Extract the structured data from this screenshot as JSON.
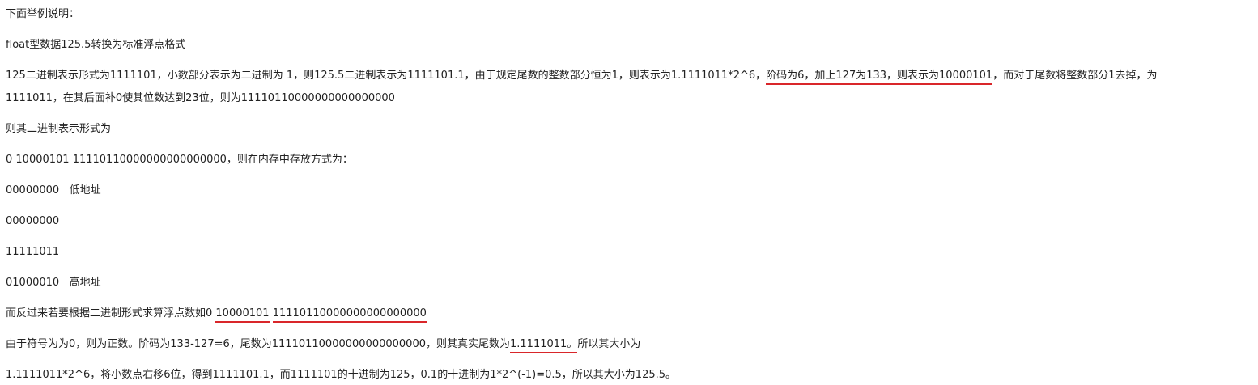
{
  "lines": {
    "l1": "下面举例说明：",
    "l2": "float型数据125.5转换为标准浮点格式",
    "l3a": "125二进制表示形式为1111101，小数部分表示为二进制为 1，则125.5二进制表示为1111101.1，由于规定尾数的整数部分恒为1，则表示为1.1111011*2^6，",
    "l3b": "阶码为6，加上127为133，则表示为10000101",
    "l3c": "，而对于尾数将整数部分1去掉，为",
    "l4": "1111011，在其后面补0使其位数达到23位，则为11110110000000000000000",
    "l5": "则其二进制表示形式为",
    "l6": "0 10000101 11110110000000000000000，则在内存中存放方式为：",
    "l7": "00000000   低地址",
    "l8": "00000000",
    "l9": "11111011",
    "l10": "01000010   高地址",
    "l11a": "而反过来若要根据二进制形式求算浮点数如0 ",
    "l11b": "10000101",
    "l11c": " ",
    "l11d": "11110110000000000000000",
    "l12a": "由于符号为为0，则为正数。阶码为133-127=6，尾数为11110110000000000000000，则其真实尾数为",
    "l12b": "1.1111011。",
    "l12c": "所以其大小为",
    "l13": "1.1111011*2^6，将小数点右移6位，得到1111101.1，而1111101的十进制为125，0.1的十进制为1*2^(-1)=0.5，所以其大小为125.5。"
  },
  "colors": {
    "text": "#222222",
    "underline": "#d9262a"
  }
}
